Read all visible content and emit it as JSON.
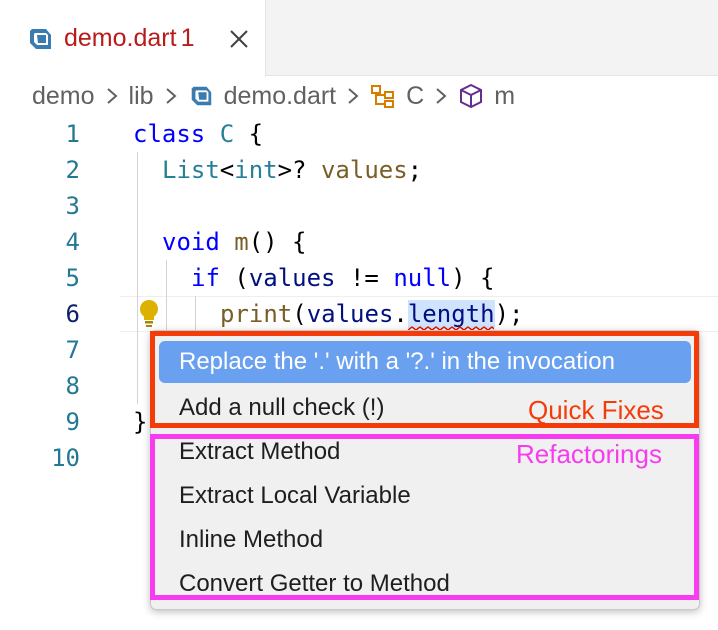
{
  "tab": {
    "file_name": "demo.dart",
    "problem_count": "1",
    "icon": "dart-file-icon",
    "close_icon": "close-icon"
  },
  "breadcrumb": {
    "items": [
      "demo",
      "lib",
      "demo.dart",
      "C",
      "m"
    ],
    "icons": [
      "dart-file-icon",
      "class-icon",
      "method-icon"
    ]
  },
  "editor": {
    "line_numbers": [
      "1",
      "2",
      "3",
      "4",
      "5",
      "6",
      "7",
      "8",
      "9",
      "10"
    ],
    "current_line": "6",
    "code": {
      "l1_kw": "class",
      "l1_name": "C",
      "l1_brace": " {",
      "l2_type": "List",
      "l2_lt": "<",
      "l2_int": "int",
      "l2_rest": ">? ",
      "l2_var": "values",
      "l2_semi": ";",
      "l4_kw": "void",
      "l4_fn": "m",
      "l4_rest": "() {",
      "l5_kw": "if",
      "l5_open": " (",
      "l5_var": "values",
      "l5_op": " != ",
      "l5_null": "null",
      "l5_rest": ") {",
      "l6_fn": "print",
      "l6_open": "(",
      "l6_var": "values",
      "l6_dot": ".",
      "l6_prop": "length",
      "l6_rest": ");",
      "l9_brace": "}"
    }
  },
  "menu": {
    "quick_fixes": [
      "Replace the '.' with a '?.' in the invocation",
      "Add a null check (!)"
    ],
    "refactorings": [
      "Extract Method",
      "Extract Local Variable",
      "Inline Method",
      "Convert Getter to Method"
    ]
  },
  "annotations": {
    "quick_fixes_label": "Quick Fixes",
    "refactorings_label": "Refactorings",
    "quick_color": "#f43b0a",
    "refactor_color": "#f73cf0"
  },
  "colors": {
    "keyword": "#0000ff",
    "type": "#267f99",
    "function": "#795e26",
    "variable": "#001080",
    "highlight": "#6aa0f0"
  }
}
